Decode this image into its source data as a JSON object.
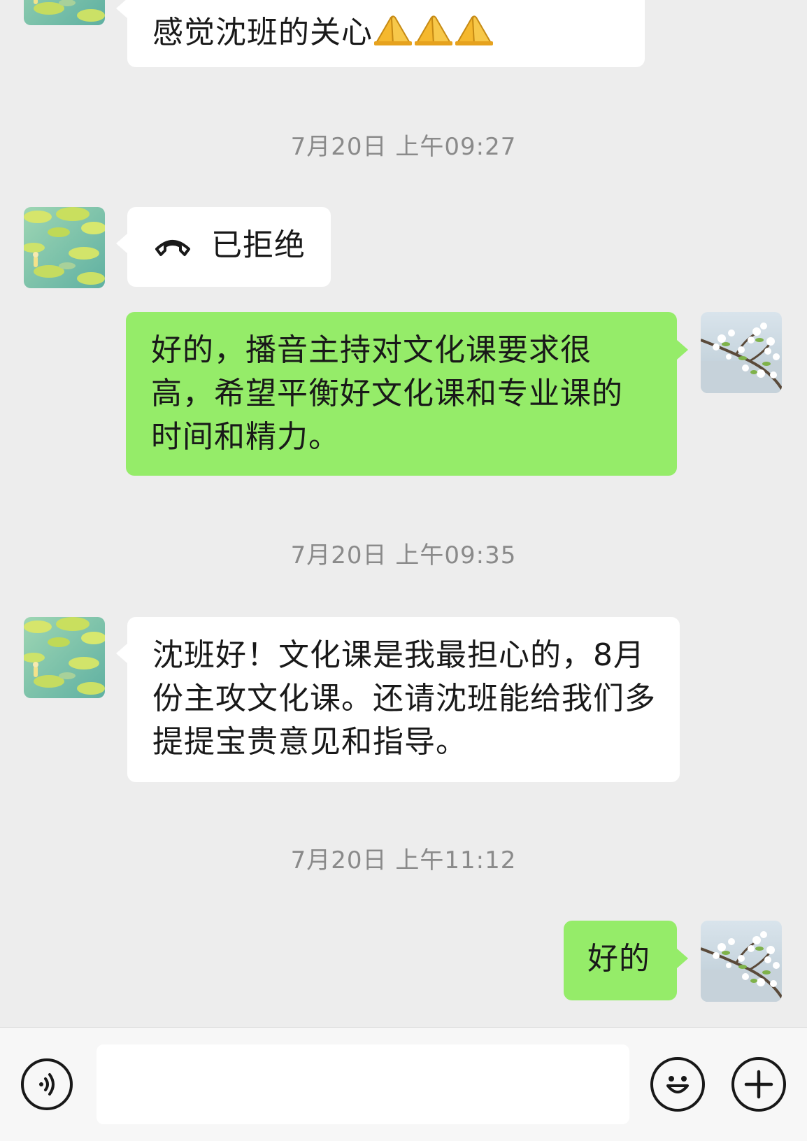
{
  "messages": {
    "first_partial": "感觉沈班的关心",
    "ts1": "7月20日 上午09:27",
    "call_status": "已拒绝",
    "reply1": "好的，播音主持对文化课要求很高，希望平衡好文化课和专业课的时间和精力。",
    "ts2": "7月20日 上午09:35",
    "incoming2": "沈班好！文化课是我最担心的，8月份主攻文化课。还请沈班能给我们多提提宝贵意见和指导。",
    "ts3": "7月20日 上午11:12",
    "reply2": "好的"
  },
  "icons": {
    "voice": "voice-icon",
    "emoji": "emoji-icon",
    "plus": "plus-icon",
    "call": "phone-hangup-icon",
    "pray": "pray-emoji-icon"
  },
  "colors": {
    "background": "#ededed",
    "incoming_bubble": "#ffffff",
    "outgoing_bubble": "#95ec69",
    "timestamp": "#8a8a8a",
    "bottom_bar": "#f7f7f7"
  },
  "input": {
    "value": "",
    "placeholder": ""
  }
}
